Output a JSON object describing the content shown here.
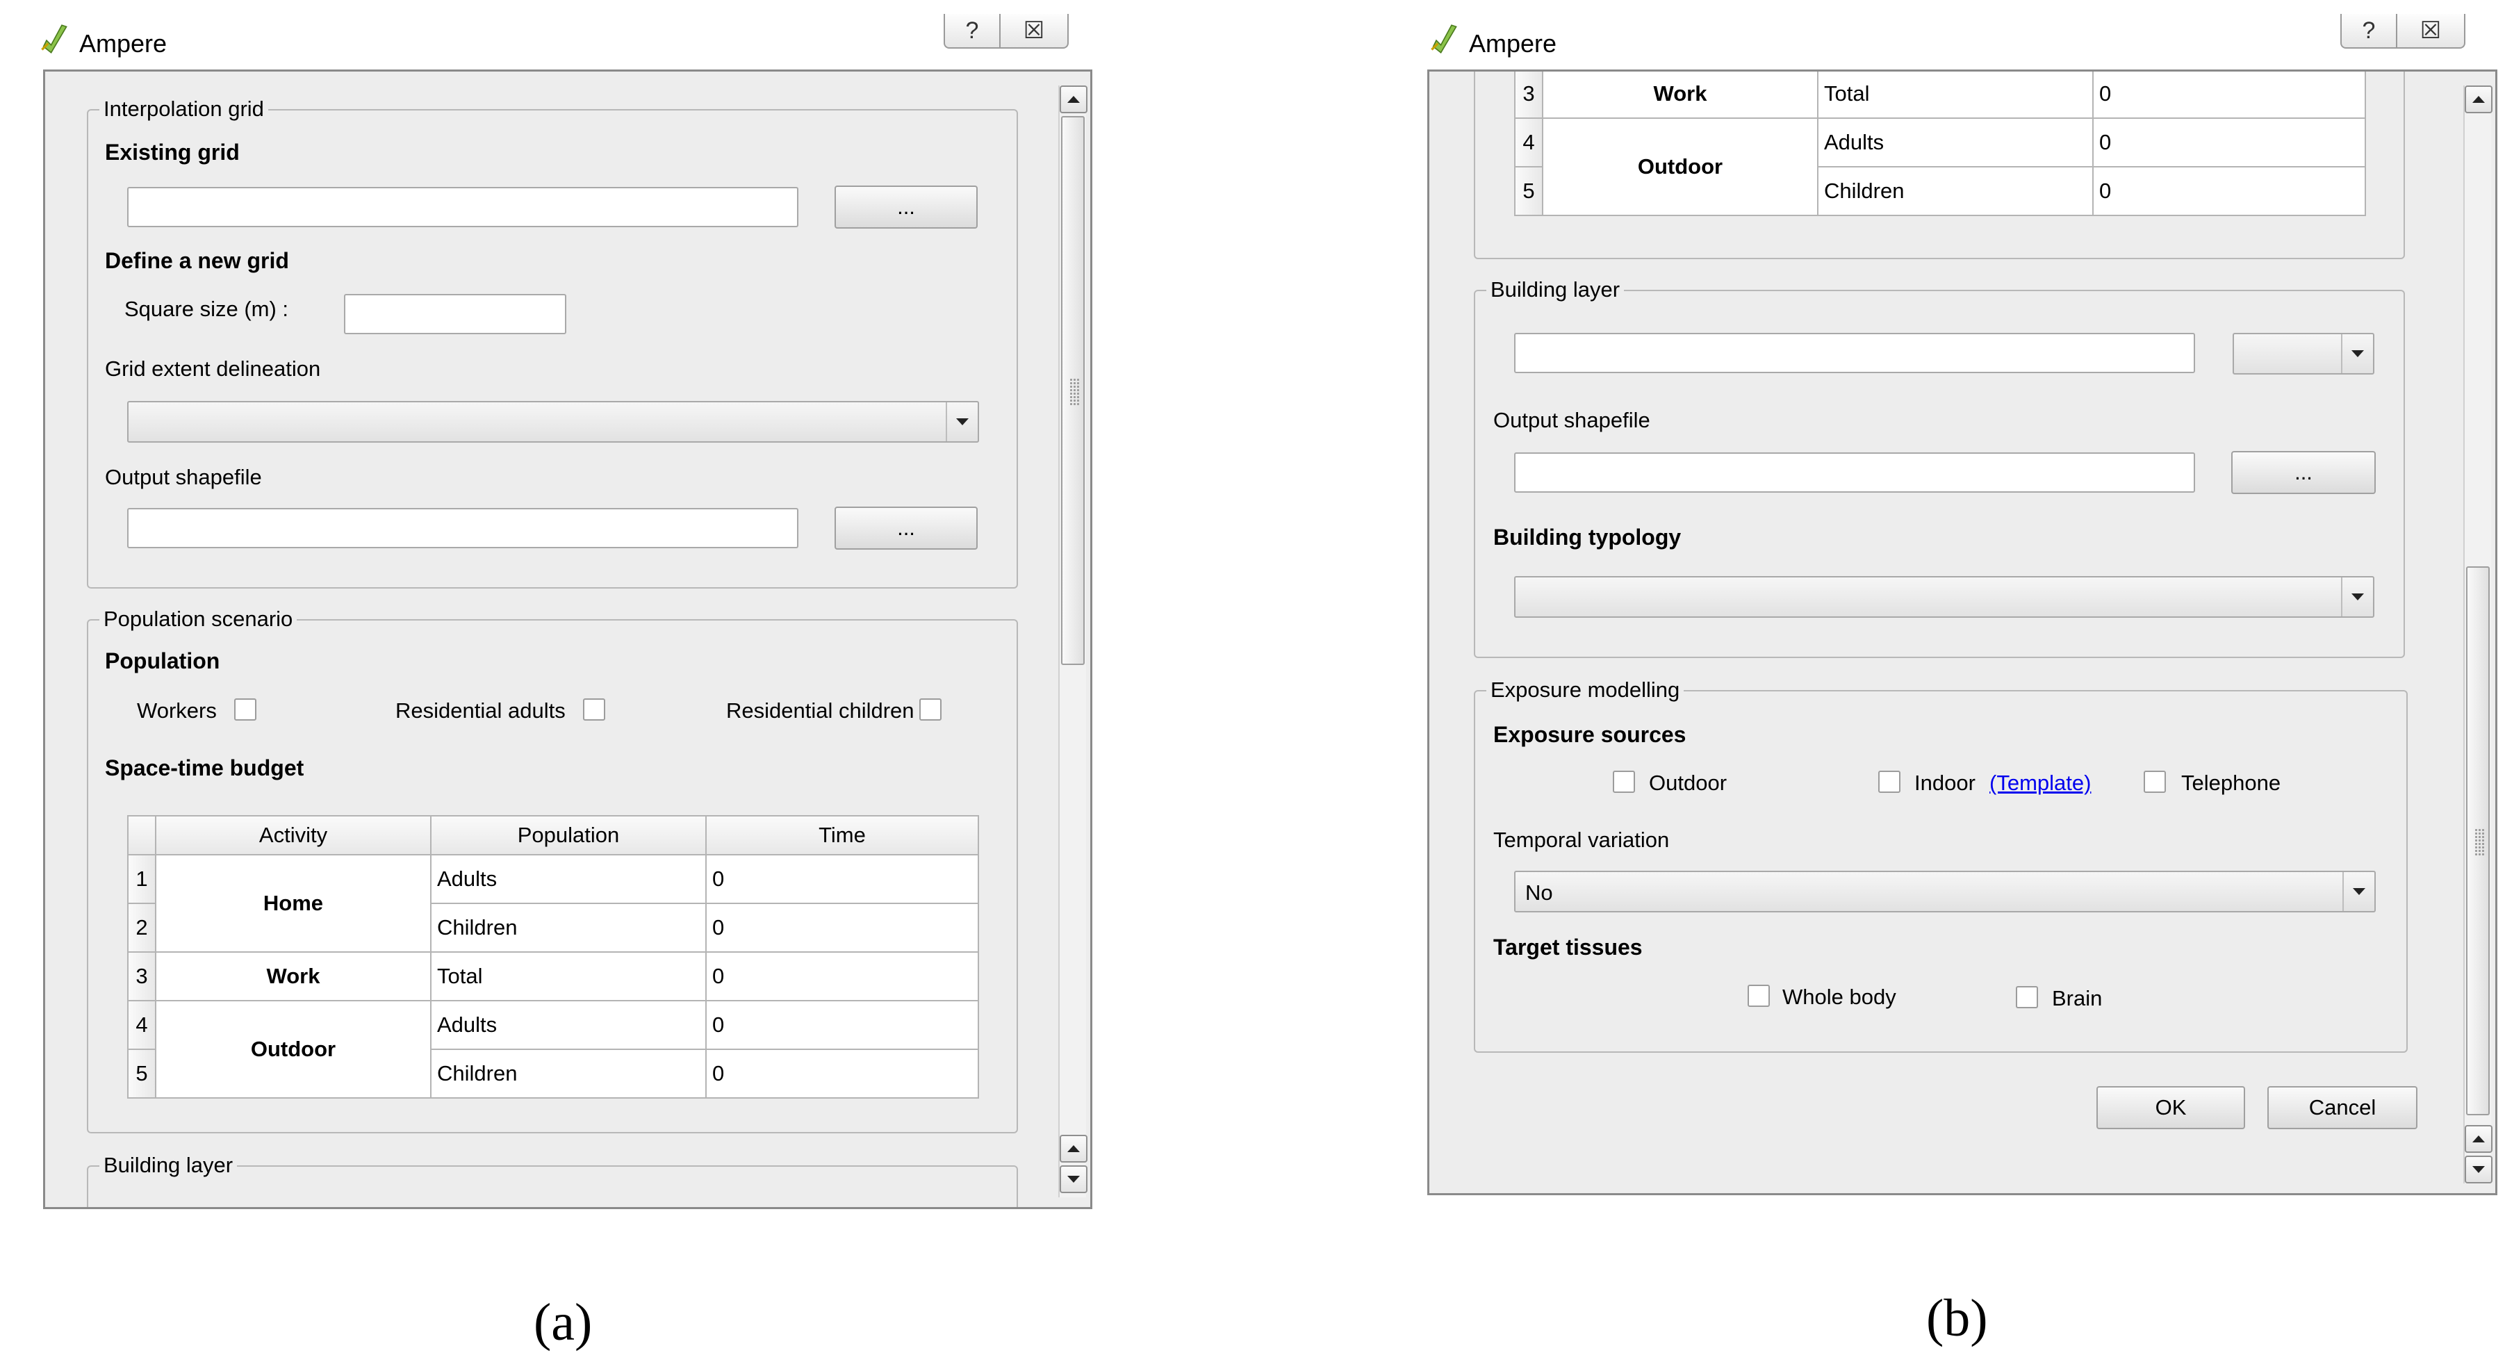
{
  "panel_a": {
    "window_title": "Ampere",
    "help_button": "?",
    "close_button": "☒",
    "interpolation_grid": {
      "title": "Interpolation grid",
      "existing_grid_label": "Existing grid",
      "existing_grid_value": "",
      "browse_label": "...",
      "define_new_grid_label": "Define a new grid",
      "square_size_label": "Square size (m) :",
      "square_size_value": "",
      "grid_extent_label": "Grid extent delineation",
      "grid_extent_value": "",
      "output_shapefile_label": "Output shapefile",
      "output_shapefile_value": "",
      "output_browse_label": "..."
    },
    "population_scenario": {
      "title": "Population scenario",
      "population_label": "Population",
      "checkboxes": [
        {
          "label": "Workers",
          "checked": false
        },
        {
          "label": "Residential adults",
          "checked": false
        },
        {
          "label": "Residential children",
          "checked": false
        }
      ],
      "space_time_label": "Space-time budget",
      "table": {
        "headers": [
          "Activity",
          "Population",
          "Time"
        ],
        "rows": [
          {
            "num": "1",
            "population": "Adults",
            "time": "0"
          },
          {
            "num": "2",
            "population": "Children",
            "time": "0"
          },
          {
            "num": "3",
            "population": "Total",
            "time": "0"
          },
          {
            "num": "4",
            "population": "Adults",
            "time": "0"
          },
          {
            "num": "5",
            "population": "Children",
            "time": "0"
          }
        ],
        "activities": [
          "Home",
          "Work",
          "Outdoor"
        ]
      }
    },
    "building_layer_title": "Building layer",
    "caption": "(a)"
  },
  "panel_b": {
    "window_title": "Ampere",
    "help_button": "?",
    "close_button": "☒",
    "table": {
      "rows": [
        {
          "num": "3",
          "activity": "Work",
          "population": "Total",
          "time": "0"
        },
        {
          "num": "4",
          "activity": "Outdoor",
          "population": "Adults",
          "time": "0"
        },
        {
          "num": "5",
          "population": "Children",
          "time": "0"
        }
      ]
    },
    "building_layer": {
      "title": "Building layer",
      "layer_value": "",
      "combo_value": "",
      "output_shapefile_label": "Output shapefile",
      "output_shapefile_value": "",
      "browse_label": "...",
      "building_typology_label": "Building typology",
      "building_typology_value": ""
    },
    "exposure_modelling": {
      "title": "Exposure modelling",
      "exposure_sources_label": "Exposure sources",
      "sources": [
        {
          "label": "Outdoor",
          "checked": false
        },
        {
          "label": "Indoor",
          "checked": false
        },
        {
          "label": "Telephone",
          "checked": false
        }
      ],
      "template_link": "(Template)",
      "temporal_variation_label": "Temporal variation",
      "temporal_variation_value": "No",
      "target_tissues_label": "Target tissues",
      "tissues": [
        {
          "label": "Whole body",
          "checked": false
        },
        {
          "label": "Brain",
          "checked": false
        }
      ]
    },
    "ok_label": "OK",
    "cancel_label": "Cancel",
    "caption": "(b)"
  }
}
